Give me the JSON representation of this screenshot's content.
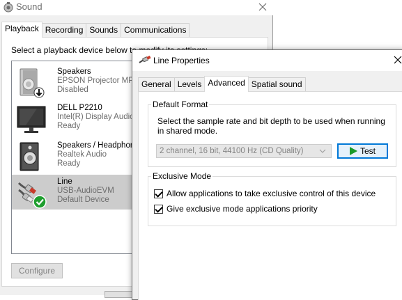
{
  "sound_window": {
    "title": "Sound",
    "tabs": [
      {
        "label": "Playback",
        "active": true
      },
      {
        "label": "Recording",
        "active": false
      },
      {
        "label": "Sounds",
        "active": false
      },
      {
        "label": "Communications",
        "active": false
      }
    ],
    "instruction": "Select a playback device below to modify its settings:",
    "devices": [
      {
        "name": "Speakers",
        "line2": "EPSON Projector MPP",
        "status": "Disabled",
        "icon": "speaker-disabled-icon"
      },
      {
        "name": "DELL P2210",
        "line2": "Intel(R) Display Audio",
        "status": "Ready",
        "icon": "monitor-icon"
      },
      {
        "name": "Speakers / Headphones",
        "line2": "Realtek Audio",
        "status": "Ready",
        "icon": "speaker-icon"
      },
      {
        "name": "Line",
        "line2": "USB-AudioEVM",
        "status": "Default Device",
        "icon": "rca-cable-default-icon",
        "selected": true
      }
    ],
    "configure_label": "Configure"
  },
  "line_properties": {
    "title": "Line Properties",
    "tabs": [
      {
        "label": "General",
        "active": false
      },
      {
        "label": "Levels",
        "active": false
      },
      {
        "label": "Advanced",
        "active": true
      },
      {
        "label": "Spatial sound",
        "active": false
      }
    ],
    "default_format": {
      "group_label": "Default Format",
      "description": "Select the sample rate and bit depth to be used when running in shared mode.",
      "selected_format": "2 channel, 16 bit, 44100 Hz (CD Quality)",
      "test_label": "Test"
    },
    "exclusive_mode": {
      "group_label": "Exclusive Mode",
      "allow_exclusive": {
        "label": "Allow applications to take exclusive control of this device",
        "checked": true
      },
      "exclusive_priority": {
        "label": "Give exclusive mode applications priority",
        "checked": true
      }
    }
  },
  "colors": {
    "accent": "#0078d7",
    "selection": "#cccccc",
    "play_green": "#1a9a2a",
    "default_badge": "#1e9e2e"
  }
}
